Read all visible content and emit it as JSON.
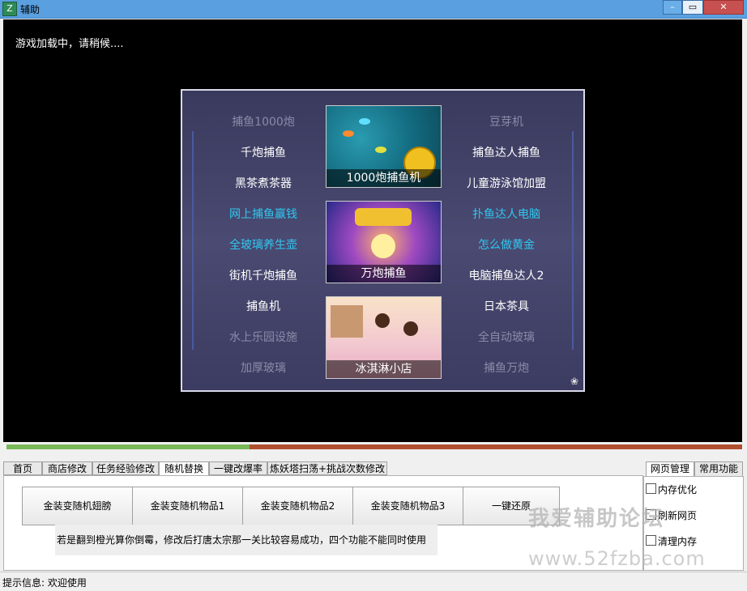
{
  "window": {
    "title": "辅助",
    "minimize_glyph": "–",
    "maximize_glyph": "▭",
    "close_glyph": "✕"
  },
  "game": {
    "loading_text": "游戏加载中，请稍候....",
    "left_links": [
      {
        "label": "捕鱼1000炮",
        "style": "dim"
      },
      {
        "label": "千炮捕鱼",
        "style": "white"
      },
      {
        "label": "黑茶煮茶器",
        "style": "white"
      },
      {
        "label": "网上捕鱼赢钱",
        "style": "cyan"
      },
      {
        "label": "全玻璃养生壶",
        "style": "cyan"
      },
      {
        "label": "街机千炮捕鱼",
        "style": "white"
      },
      {
        "label": "捕鱼机",
        "style": "white"
      },
      {
        "label": "水上乐园设施",
        "style": "dim"
      },
      {
        "label": "加厚玻璃",
        "style": "dim"
      }
    ],
    "right_links": [
      {
        "label": "豆芽机",
        "style": "dim"
      },
      {
        "label": "捕鱼达人捕鱼",
        "style": "white"
      },
      {
        "label": "儿童游泳馆加盟",
        "style": "white"
      },
      {
        "label": "扑鱼达人电脑",
        "style": "cyan"
      },
      {
        "label": "怎么做黄金",
        "style": "cyan"
      },
      {
        "label": "电脑捕鱼达人2",
        "style": "white"
      },
      {
        "label": "日本茶具",
        "style": "white"
      },
      {
        "label": "全自动玻璃",
        "style": "dim"
      },
      {
        "label": "捕鱼万炮",
        "style": "dim"
      }
    ],
    "thumbnails": [
      {
        "caption": "1000炮捕鱼机"
      },
      {
        "caption": "万炮捕鱼"
      },
      {
        "caption": "冰淇淋小店"
      }
    ],
    "paw_icon": "paw-icon"
  },
  "progress": {
    "value": 0.33
  },
  "tabs": [
    {
      "label": "首页",
      "active": false
    },
    {
      "label": "商店修改",
      "active": false
    },
    {
      "label": "任务经验修改",
      "active": false
    },
    {
      "label": "随机替换",
      "active": true
    },
    {
      "label": "一键改爆率",
      "active": false
    },
    {
      "label": "炼妖塔扫荡+挑战次数修改",
      "active": false
    }
  ],
  "actions": [
    {
      "label": "金装变随机翅膀"
    },
    {
      "label": "金装变随机物品1"
    },
    {
      "label": "金装变随机物品2"
    },
    {
      "label": "金装变随机物品3"
    },
    {
      "label": "一键还原"
    }
  ],
  "note": "若是翻到橙光算你倒霉，修改后打唐太宗那一关比较容易成功，四个功能不能同时使用",
  "side": {
    "tabs": [
      "网页管理",
      "常用功能"
    ],
    "checkboxes": [
      {
        "label": "内存优化",
        "checked": false
      },
      {
        "label": "刷新网页",
        "checked": false
      },
      {
        "label": "清理内存",
        "checked": false
      }
    ]
  },
  "watermark": {
    "line1": "我爱辅助论坛",
    "line2": "www.52fzba.com"
  },
  "status": {
    "text": "提示信息:  欢迎使用"
  },
  "colors": {
    "progress_done": "#78b858",
    "progress_remaining": "#b05030",
    "link_cyan": "#2fc8f0"
  }
}
